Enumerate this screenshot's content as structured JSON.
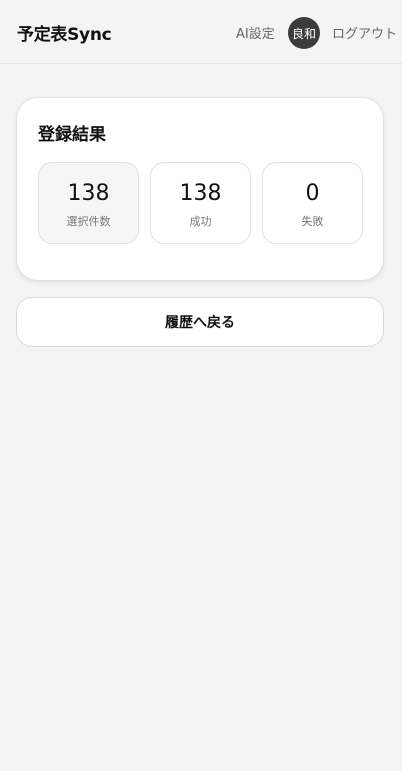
{
  "header": {
    "title": "予定表Sync",
    "ai_settings_label": "AI設定",
    "user_initials": "良和",
    "logout_label": "ログアウト"
  },
  "result": {
    "title": "登録結果",
    "stats": [
      {
        "value": "138",
        "label": "選択件数"
      },
      {
        "value": "138",
        "label": "成功"
      },
      {
        "value": "0",
        "label": "失敗"
      }
    ]
  },
  "back_button_label": "履歴へ戻る"
}
